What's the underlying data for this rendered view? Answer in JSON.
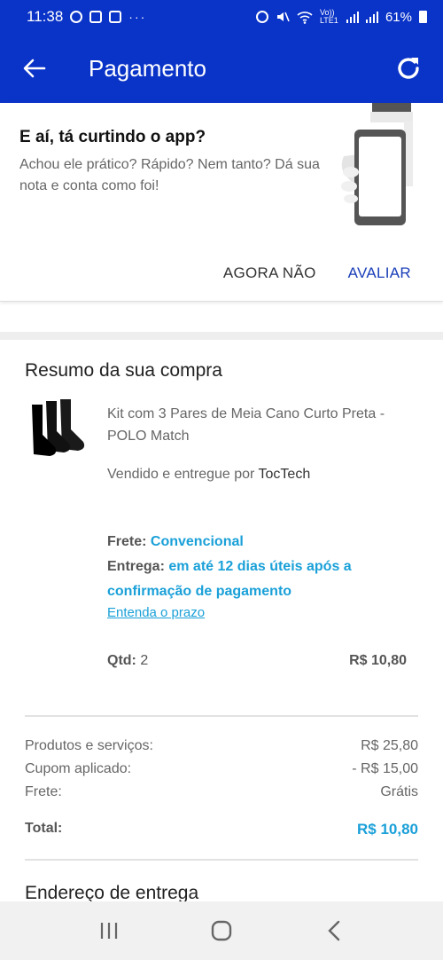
{
  "status_bar": {
    "time": "11:38",
    "dots": "···",
    "network_label": "Vo)) LTE1",
    "battery": "61%"
  },
  "app_bar": {
    "title": "Pagamento"
  },
  "rating_card": {
    "title": "E aí, tá curtindo o app?",
    "description": "Achou ele prático? Rápido? Nem tanto? Dá sua nota e conta como foi!",
    "not_now_label": "AGORA NÃO",
    "rate_label": "AVALIAR"
  },
  "summary": {
    "title": "Resumo da sua compra",
    "product_name": "Kit com 3 Pares de Meia Cano Curto Preta - POLO Match",
    "seller_prefix": "Vendido e entregue por",
    "seller_name": "TocTech",
    "shipping_label": "Frete:",
    "shipping_value": "Convencional",
    "delivery_label": "Entrega:",
    "delivery_value": "em até 12 dias úteis após a confirmação de pagamento",
    "deadline_link": "Entenda o prazo",
    "qty_label": "Qtd:",
    "qty_value": "2",
    "item_price": "R$ 10,80"
  },
  "totals": {
    "rows": [
      {
        "label": "Produtos e serviços:",
        "value": "R$ 25,80"
      },
      {
        "label": "Cupom aplicado:",
        "value": "- R$ 15,00"
      },
      {
        "label": "Frete:",
        "value": "Grátis"
      }
    ],
    "total_label": "Total:",
    "total_value": "R$ 10,80"
  },
  "address": {
    "title": "Endereço de entrega"
  },
  "icons": {
    "back": "arrow-left-icon",
    "refresh": "refresh-icon",
    "nav_recent": "recent-apps-icon",
    "nav_home": "home-icon",
    "nav_back": "chevron-left-icon"
  },
  "colors": {
    "brand_blue": "#0a33c8",
    "accent_cyan": "#1aa0d8",
    "action_blue": "#1a3fb8"
  }
}
